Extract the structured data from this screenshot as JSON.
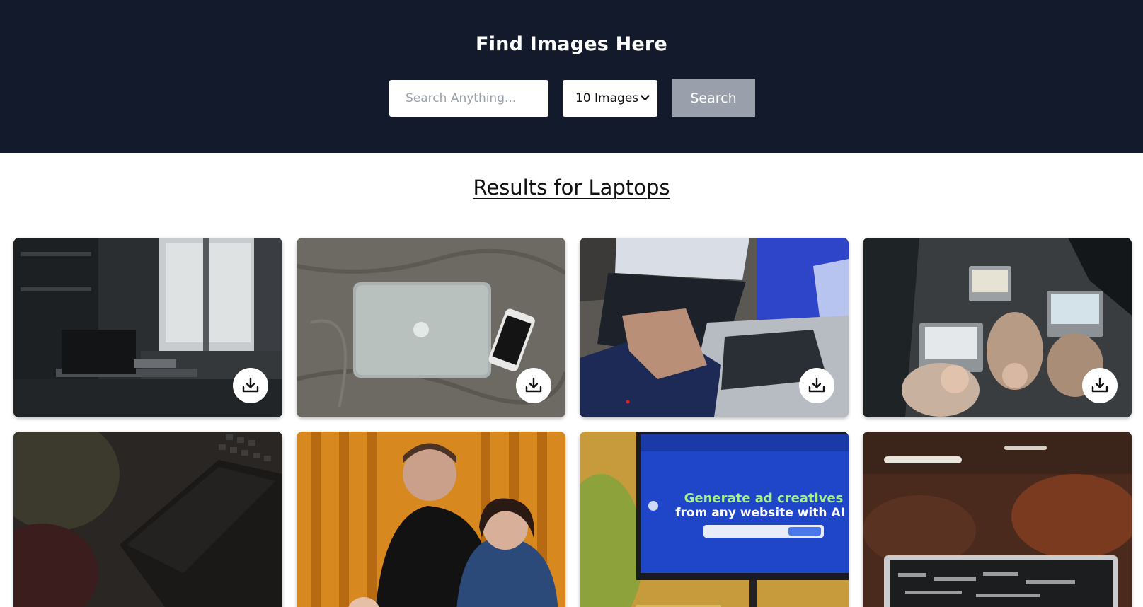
{
  "header": {
    "title": "Find Images Here",
    "search_placeholder": "Search Anything...",
    "count_select_value": "10 Images",
    "search_button_label": "Search",
    "background_color": "#131a2b"
  },
  "results": {
    "heading": "Results for Laptops"
  },
  "cards": [
    {
      "subject": "laptop on desk by window",
      "download_icon": "download-icon"
    },
    {
      "subject": "closed laptop and phone on bed",
      "download_icon": "download-icon"
    },
    {
      "subject": "hands typing on two laptops",
      "download_icon": "download-icon"
    },
    {
      "subject": "people with laptops from above",
      "download_icon": "download-icon"
    },
    {
      "subject": "dark laptop close-up"
    },
    {
      "subject": "man and woman smiling at laptop"
    },
    {
      "subject": "monitor showing website",
      "screen_text_1": "Generate ad creatives",
      "screen_text_2": "from any website with AI"
    },
    {
      "subject": "laptop in blurred cafe"
    }
  ]
}
